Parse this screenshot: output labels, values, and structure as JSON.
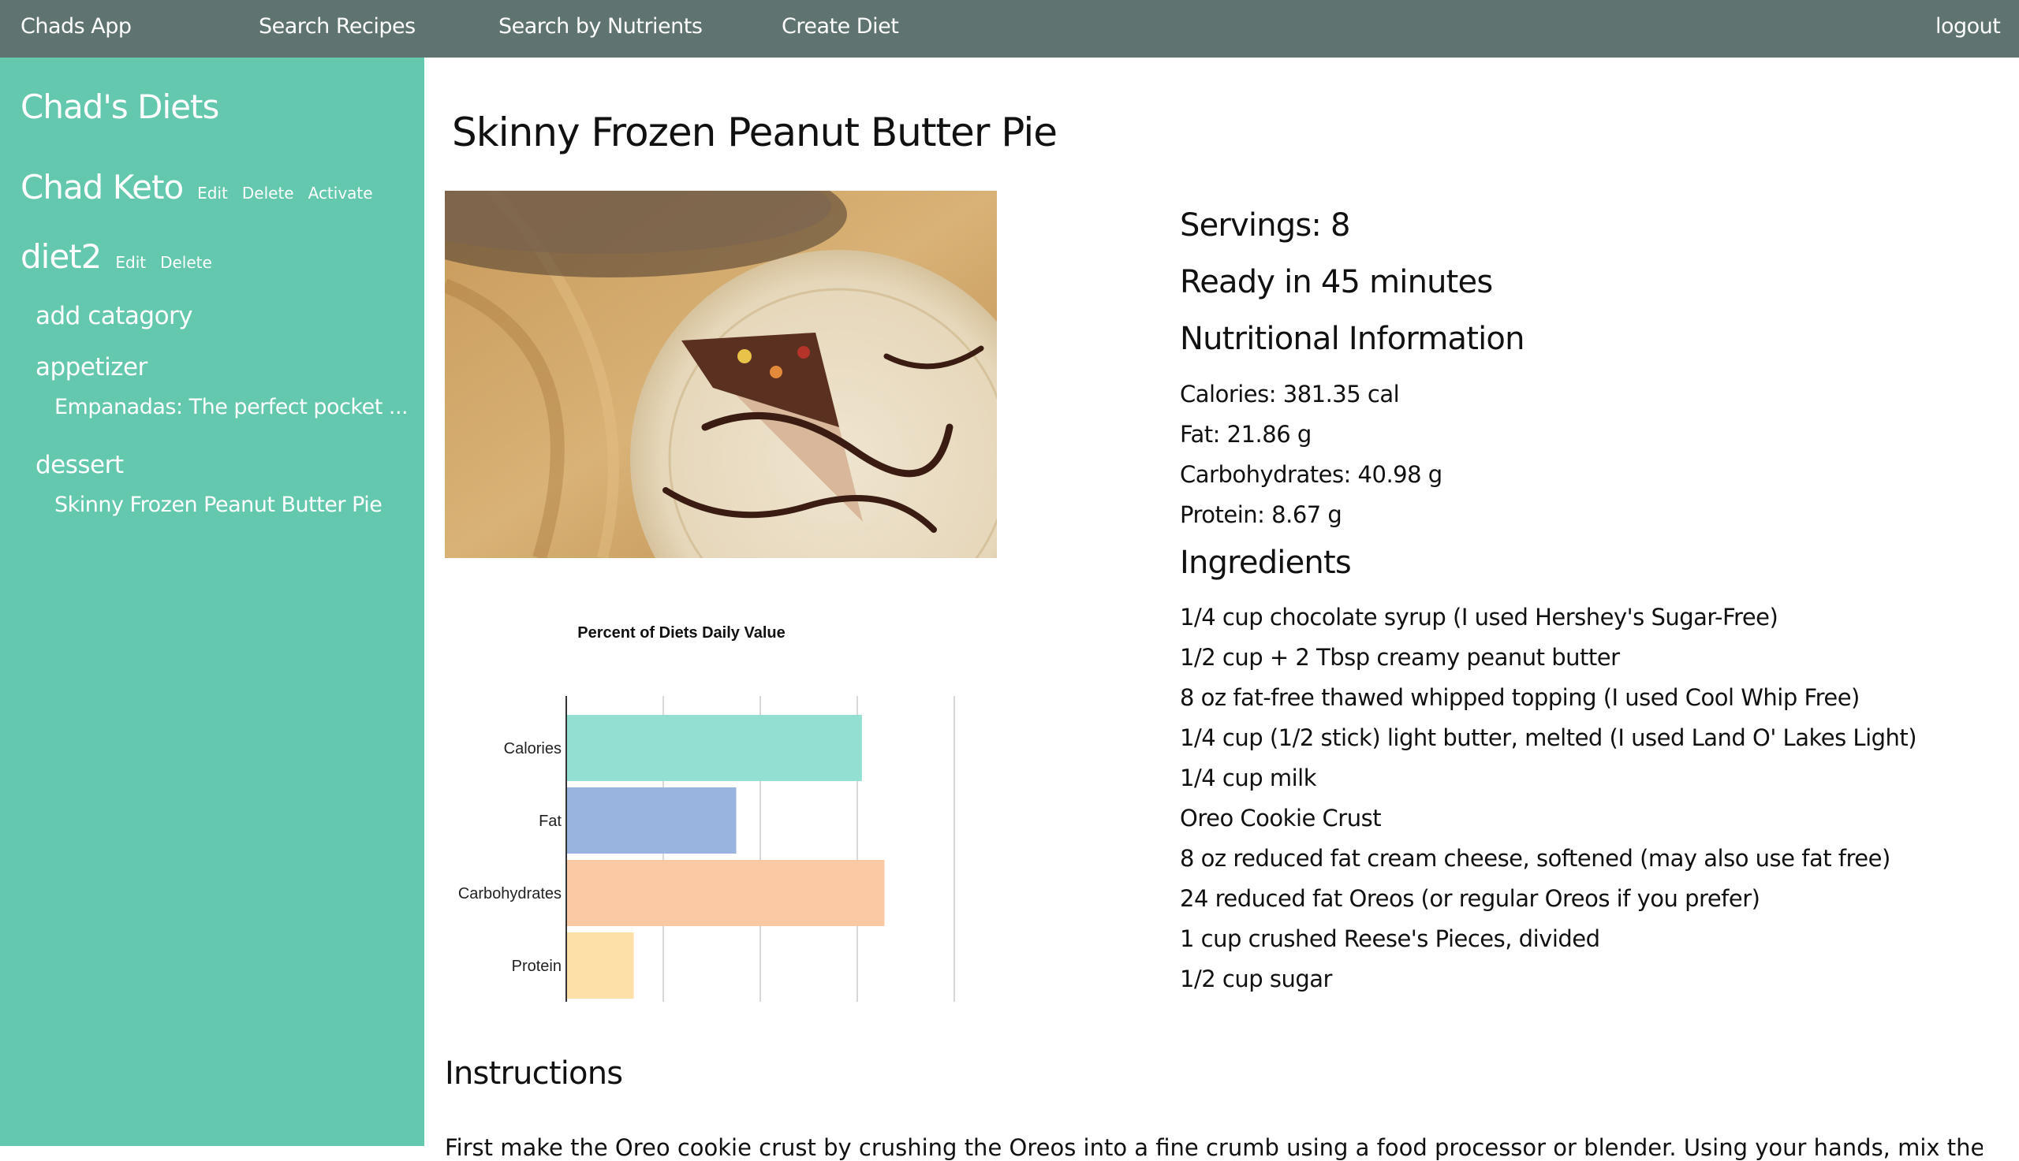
{
  "navbar": {
    "brand": "Chads App",
    "links": [
      "Search Recipes",
      "Search by Nutrients",
      "Create Diet"
    ],
    "logout": "logout"
  },
  "sidebar": {
    "title": "Chad's Diets",
    "diets": [
      {
        "name": "Chad Keto",
        "actions": [
          "Edit",
          "Delete",
          "Activate"
        ]
      },
      {
        "name": "diet2",
        "actions": [
          "Edit",
          "Delete"
        ]
      }
    ],
    "categories": [
      {
        "label": "add catagory",
        "recipes": []
      },
      {
        "label": "appetizer",
        "recipes": [
          "Empanadas: The perfect pocket ..."
        ]
      },
      {
        "label": "dessert",
        "recipes": [
          "Skinny Frozen Peanut Butter Pie"
        ]
      }
    ]
  },
  "recipe": {
    "title": "Skinny Frozen Peanut Butter Pie",
    "servings": "Servings: 8",
    "ready": "Ready in 45 minutes",
    "nutrition_heading": "Nutritional Information",
    "nutrition": [
      "Calories: 381.35 cal",
      "Fat: 21.86 g",
      "Carbohydrates: 40.98 g",
      "Protein: 8.67 g"
    ],
    "ingredients_heading": "Ingredients",
    "ingredients": [
      "1/4 cup chocolate syrup (I used Hershey's Sugar-Free)",
      "1/2 cup + 2 Tbsp creamy peanut butter",
      "8 oz fat-free thawed whipped topping (I used Cool Whip Free)",
      "1/4 cup (1/2 stick) light butter, melted (I used Land O' Lakes Light)",
      "1/4 cup milk",
      "Oreo Cookie Crust",
      "8 oz reduced fat cream cheese, softened (may also use fat free)",
      "24 reduced fat Oreos (or regular Oreos if you prefer)",
      "1 cup crushed Reese's Pieces, divided",
      "1/2 cup sugar"
    ],
    "instructions_heading": "Instructions",
    "instructions_text": "First make the Oreo cookie crust by crushing the Oreos into a fine crumb using a food processor or blender. Using your hands, mix the crushed Oreo crumbs and melted butter."
  },
  "colors": {
    "navbar": "#5f7470",
    "sidebar": "#64c8ae"
  },
  "chart_data": {
    "type": "bar",
    "title": "Percent of Diets Daily Value",
    "categories": [
      "Calories",
      "Fat",
      "Carbohydrates",
      "Protein"
    ],
    "values": [
      38.1,
      21.9,
      41.0,
      8.7
    ],
    "colors": [
      "#93e0d3",
      "#9ab4e0",
      "#fcc9a5",
      "#fde0a8"
    ],
    "xlim": [
      0,
      50
    ],
    "xticks": [
      "0.0",
      "12.5",
      "25.0",
      "37.5",
      "50.0"
    ],
    "grid": true,
    "orientation": "horizontal"
  }
}
